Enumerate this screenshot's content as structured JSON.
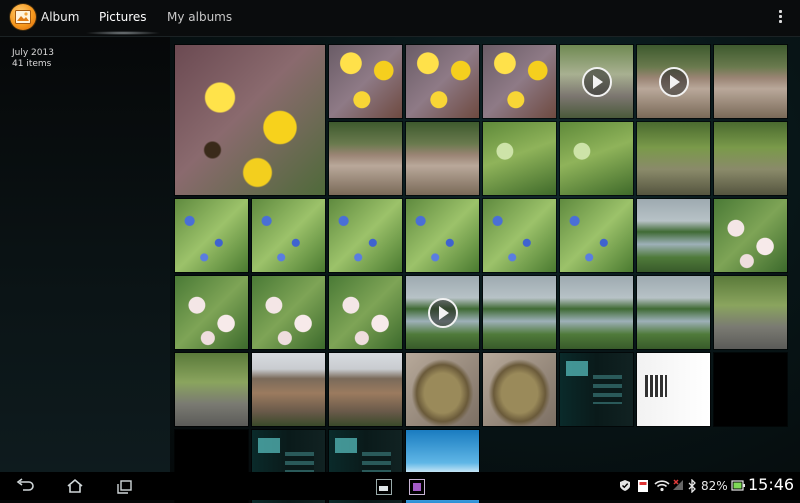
{
  "app": {
    "title": "Album"
  },
  "tabs": [
    {
      "label": "Pictures"
    },
    {
      "label": "My albums"
    }
  ],
  "info": {
    "date": "July 2013",
    "count": "41 items"
  },
  "status": {
    "battery": "82%",
    "time": "15:46"
  },
  "colors": {
    "accent": "#33b5e5",
    "battery_green": "#7ed957",
    "app_icon": "#f7981d"
  },
  "thumbnails": [
    {
      "subject": "yellow flowers with bee",
      "type": "photo"
    },
    {
      "subject": "yellow flowers",
      "type": "photo"
    },
    {
      "subject": "yellow flowers",
      "type": "photo"
    },
    {
      "subject": "yellow flowers",
      "type": "photo"
    },
    {
      "subject": "garden",
      "type": "video"
    },
    {
      "subject": "brick wall",
      "type": "video"
    },
    {
      "subject": "brick wall",
      "type": "photo"
    },
    {
      "subject": "brick wall",
      "type": "photo"
    },
    {
      "subject": "brick wall",
      "type": "photo"
    },
    {
      "subject": "green plants",
      "type": "photo"
    },
    {
      "subject": "green plants",
      "type": "photo"
    },
    {
      "subject": "garden path",
      "type": "photo"
    },
    {
      "subject": "garden path",
      "type": "photo"
    },
    {
      "subject": "blue flowers",
      "type": "photo"
    },
    {
      "subject": "blue flowers",
      "type": "photo"
    },
    {
      "subject": "blue flowers",
      "type": "photo"
    },
    {
      "subject": "blue flowers",
      "type": "photo"
    },
    {
      "subject": "blue flowers",
      "type": "photo"
    },
    {
      "subject": "blue flowers",
      "type": "photo"
    },
    {
      "subject": "canal",
      "type": "photo"
    },
    {
      "subject": "white flowers",
      "type": "photo"
    },
    {
      "subject": "white flowers",
      "type": "photo"
    },
    {
      "subject": "white flowers",
      "type": "photo"
    },
    {
      "subject": "white flowers",
      "type": "photo"
    },
    {
      "subject": "canal",
      "type": "video"
    },
    {
      "subject": "canal",
      "type": "photo"
    },
    {
      "subject": "canal",
      "type": "photo"
    },
    {
      "subject": "canal",
      "type": "photo"
    },
    {
      "subject": "road",
      "type": "photo"
    },
    {
      "subject": "road",
      "type": "photo"
    },
    {
      "subject": "rusty wall",
      "type": "photo"
    },
    {
      "subject": "rusty wall",
      "type": "photo"
    },
    {
      "subject": "rock",
      "type": "photo"
    },
    {
      "subject": "rock",
      "type": "photo"
    },
    {
      "subject": "screenshot",
      "type": "photo"
    },
    {
      "subject": "qr code",
      "type": "photo"
    },
    {
      "subject": "black",
      "type": "photo"
    },
    {
      "subject": "black",
      "type": "photo"
    },
    {
      "subject": "screenshot",
      "type": "photo"
    },
    {
      "subject": "screenshot",
      "type": "photo"
    },
    {
      "subject": "sky",
      "type": "photo"
    }
  ]
}
